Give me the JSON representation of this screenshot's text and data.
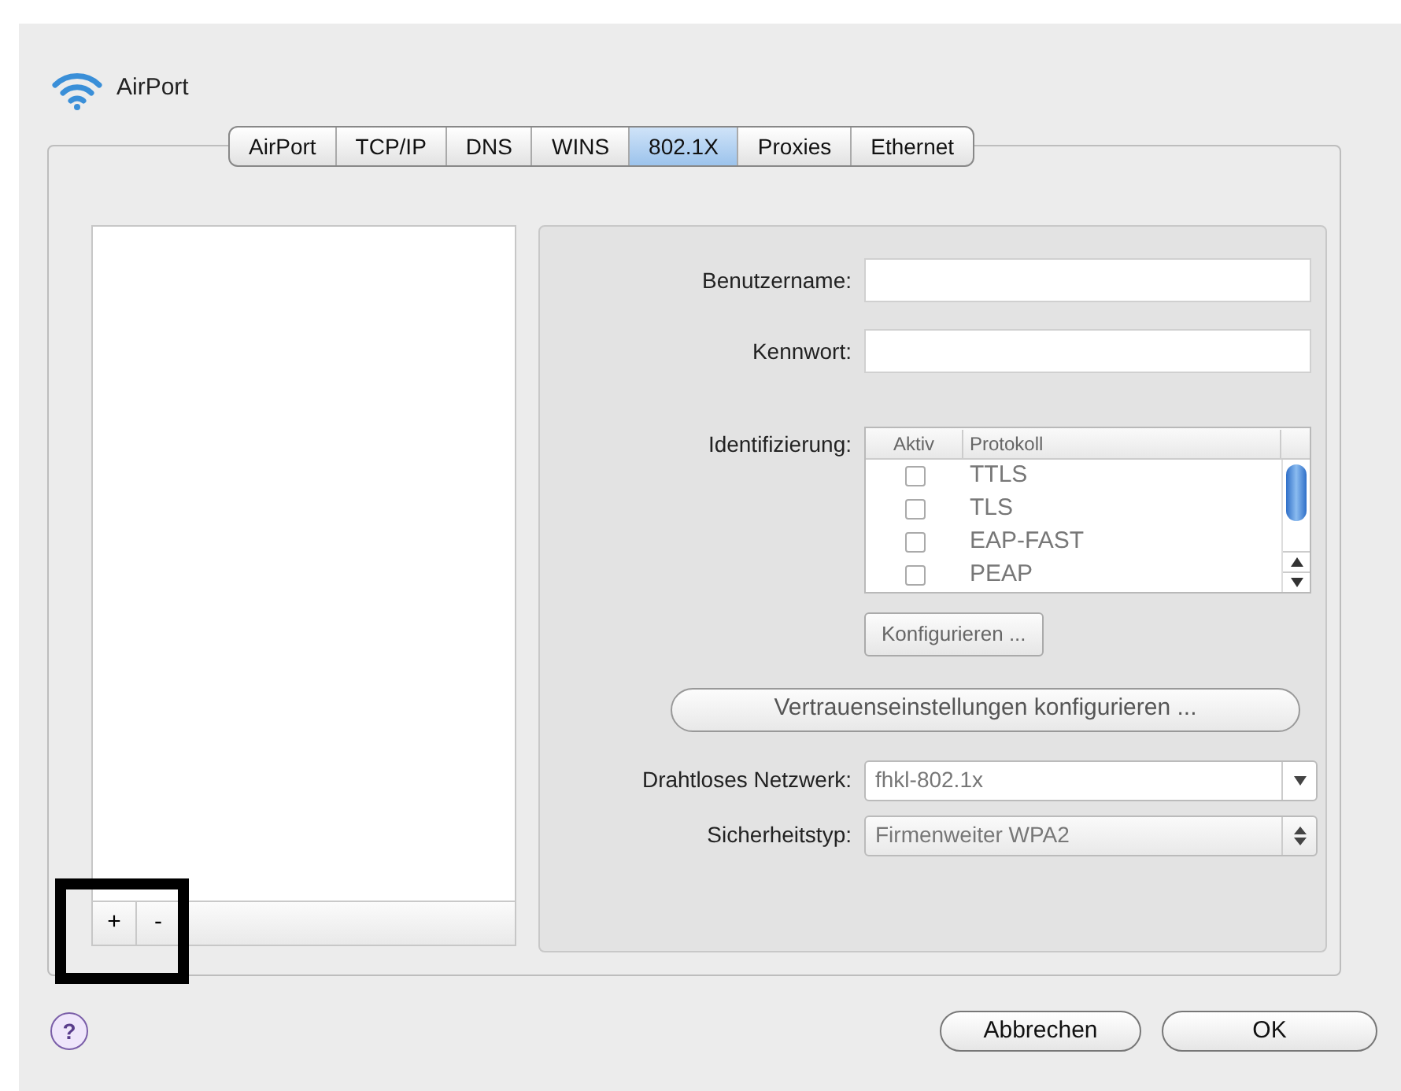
{
  "window": {
    "title": "AirPort"
  },
  "tabs": [
    {
      "label": "AirPort",
      "selected": false
    },
    {
      "label": "TCP/IP",
      "selected": false
    },
    {
      "label": "DNS",
      "selected": false
    },
    {
      "label": "WINS",
      "selected": false
    },
    {
      "label": "802.1X",
      "selected": true
    },
    {
      "label": "Proxies",
      "selected": false
    },
    {
      "label": "Ethernet",
      "selected": false
    }
  ],
  "list_buttons": [
    "+",
    "-"
  ],
  "fields": [
    {
      "label": "Benutzername:"
    },
    {
      "label": "Kennwort:"
    }
  ],
  "identification": {
    "label": "Identifizierung:",
    "columns": [
      "Aktiv",
      "Protokoll"
    ],
    "rows": [
      {
        "protocol": "TTLS",
        "checked": false
      },
      {
        "protocol": "TLS",
        "checked": false
      },
      {
        "protocol": "EAP-FAST",
        "checked": false
      },
      {
        "protocol": "PEAP",
        "checked": false
      }
    ],
    "configure_button": "Konfigurieren ..."
  },
  "trust_button": "Vertrauenseinstellungen konfigurieren ...",
  "network": {
    "label": "Drahtloses Netzwerk:",
    "value": "fhkl-802.1x"
  },
  "security": {
    "label": "Sicherheitstyp:",
    "value": "Firmenweiter WPA2"
  },
  "help": "?",
  "buttons": [
    {
      "label": "Abbrechen",
      "kind": "cancel"
    },
    {
      "label": "OK",
      "kind": "default"
    }
  ]
}
